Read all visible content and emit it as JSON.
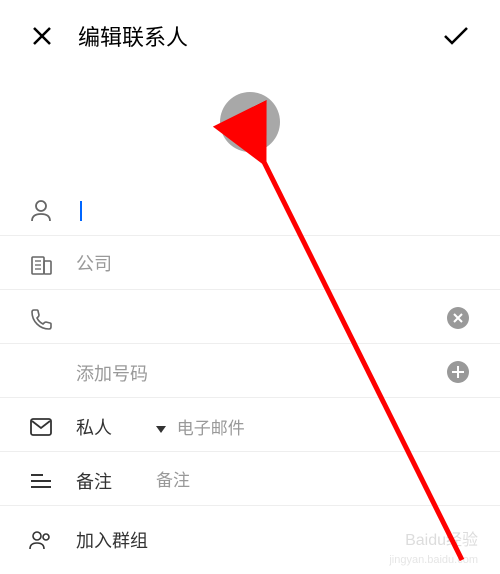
{
  "header": {
    "title": "编辑联系人"
  },
  "fields": {
    "company_placeholder": "公司",
    "add_phone_label": "添加号码",
    "email_type": "私人",
    "email_placeholder": "电子邮件",
    "notes_label": "备注",
    "notes_placeholder": "备注",
    "group_label": "加入群组"
  },
  "watermark": {
    "main": "Baidu经验",
    "sub": "jingyan.baidu.com"
  }
}
